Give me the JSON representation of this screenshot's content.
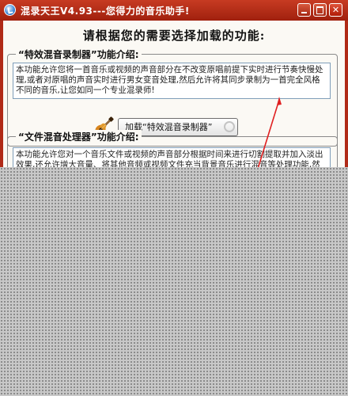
{
  "window": {
    "title": "混录天王V4.93---您得力的音乐助手!"
  },
  "main": {
    "heading": "请根据您的需要选择加载的功能:"
  },
  "section1": {
    "title": "“特效混音录制器”功能介绍:",
    "description": "本功能允许您将一首音乐或视频的声音部分在不改变原唱前提下实时进行节奏快慢处理,或者对原唱的声音实时进行男女变音处理,然后允许将其同步录制为一首完全风格不同的音乐,让您如同一个专业混录师!",
    "load_button_label": "加载“特效混音录制器”",
    "icon": "guitar-icon"
  },
  "section2": {
    "title": "“文件混音处理器”功能介绍:",
    "description": "本功能允许您对一个音乐文件或视频的声音部分根据时间来进行切割提取并加入淡出效果,还允许增大音量、将其他音频或视频文件充当背景音乐进行混音等处理功能,然后快速保存为新"
  },
  "colors": {
    "titlebar": "#b02a17",
    "window_border": "#b02a17",
    "client_bg": "#fbf9f4",
    "annotation_arrow": "#e02020",
    "overlay": "#c8c8c8"
  }
}
